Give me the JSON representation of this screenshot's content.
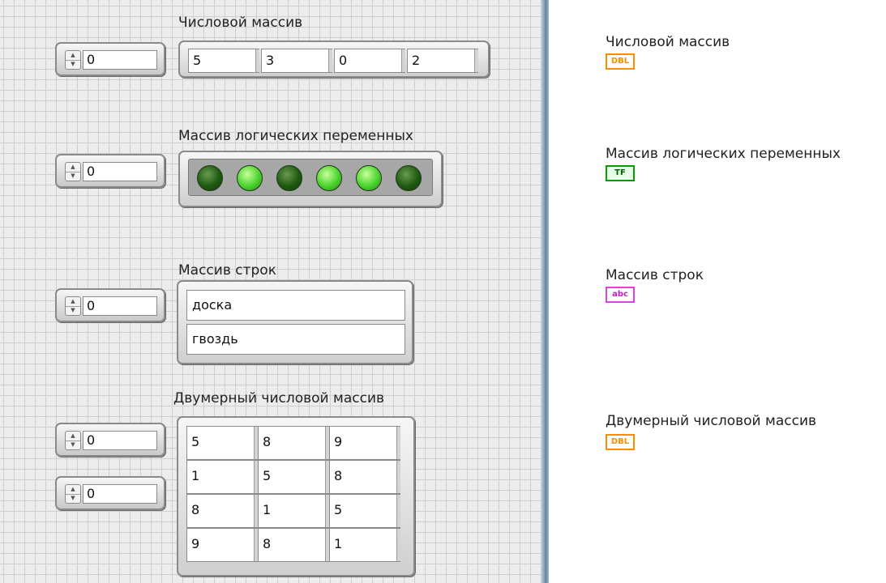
{
  "front_panel": {
    "numeric_array": {
      "label": "Числовой массив",
      "index": "0",
      "values": [
        "5",
        "3",
        "0",
        "2"
      ]
    },
    "boolean_array": {
      "label": "Массив логических переменных",
      "index": "0",
      "leds": [
        false,
        true,
        false,
        true,
        true,
        false
      ]
    },
    "string_array": {
      "label": "Массив строк",
      "index": "0",
      "values": [
        "доска",
        "гвоздь"
      ]
    },
    "matrix": {
      "label": "Двумерный числовой массив",
      "row_index": "0",
      "col_index": "0",
      "rows": [
        [
          "5",
          "8",
          "9"
        ],
        [
          "1",
          "5",
          "8"
        ],
        [
          "8",
          "1",
          "5"
        ],
        [
          "9",
          "8",
          "1"
        ]
      ]
    }
  },
  "block_diagram": {
    "terminals": [
      {
        "label": "Числовой массив",
        "badge": "DBL",
        "type": "dbl"
      },
      {
        "label": "Массив логических переменных",
        "badge": "TF",
        "type": "tf"
      },
      {
        "label": "Массив строк",
        "badge": "abc",
        "type": "str"
      },
      {
        "label": "Двумерный числовой массив",
        "badge": "DBL",
        "type": "dbl"
      }
    ]
  },
  "colors": {
    "dbl": "#ff8c00",
    "boolean": "#00a000",
    "string": "#e040e0"
  }
}
